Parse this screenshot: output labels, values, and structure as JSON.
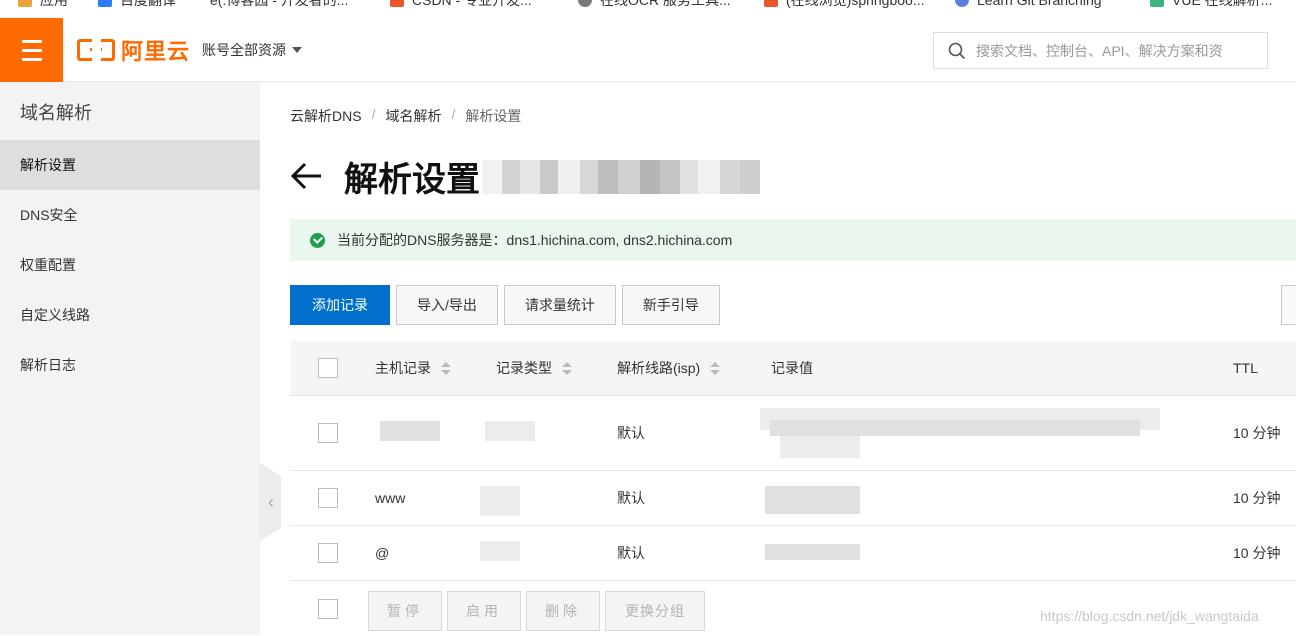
{
  "bookmarks": [
    "应用",
    "百度翻译",
    "e(:博客园 - 开发者的...",
    "CSDN - 专业开发...",
    "在线OCR 服务工具...",
    "(在线浏览)springboo...",
    "Learn Git Branching",
    "VUE 在线解析..."
  ],
  "topbar": {
    "brand": "阿里云",
    "account_menu": "账号全部资源",
    "search_placeholder": "搜索文档、控制台、API、解决方案和资"
  },
  "sidebar": {
    "title": "域名解析",
    "items": [
      {
        "label": "解析设置",
        "active": true
      },
      {
        "label": "DNS安全",
        "active": false
      },
      {
        "label": "权重配置",
        "active": false
      },
      {
        "label": "自定义线路",
        "active": false
      },
      {
        "label": "解析日志",
        "active": false
      }
    ],
    "collapse_glyph": "‹"
  },
  "breadcrumb": [
    "云解析DNS",
    "域名解析",
    "解析设置"
  ],
  "breadcrumb_sep": "/",
  "page_title": "解析设置",
  "alert": "当前分配的DNS服务器是：dns1.hichina.com, dns2.hichina.com",
  "toolbar": {
    "add": "添加记录",
    "import_export": "导入/导出",
    "stats": "请求量统计",
    "guide": "新手引导"
  },
  "table": {
    "columns": [
      "主机记录",
      "记录类型",
      "解析线路(isp)",
      "记录值",
      "TTL"
    ],
    "rows": [
      {
        "host": "",
        "type": "",
        "line": "默认",
        "value": "",
        "ttl": "10 分钟"
      },
      {
        "host": "www",
        "type": "",
        "line": "默认",
        "value": "",
        "ttl": "10 分钟"
      },
      {
        "host": "@",
        "type": "",
        "line": "默认",
        "value": "",
        "ttl": "10 分钟"
      }
    ]
  },
  "footer_actions": {
    "pause": "暂停",
    "enable": "启用",
    "delete": "删除",
    "change_group": "更换分组"
  },
  "watermark": "https://blog.csdn.net/jdk_wangtaida",
  "colors": {
    "accent": "#ff6a00",
    "primary": "#0070cc",
    "success": "#1e9f4b"
  }
}
